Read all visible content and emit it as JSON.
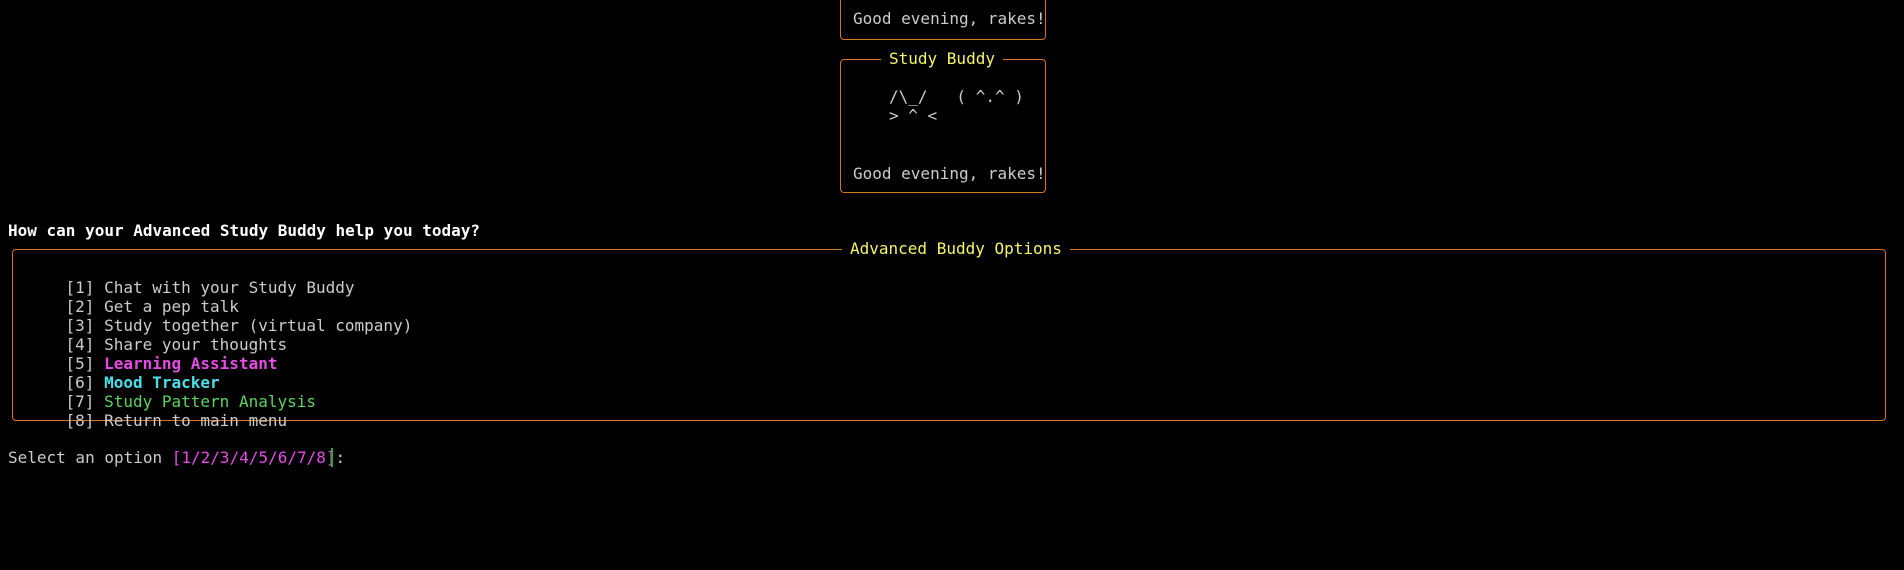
{
  "top_panel": {
    "greeting": "Good evening, rakes!"
  },
  "buddy_panel": {
    "title": "Study Buddy",
    "art_line1": "/\\_/   ( ^.^ )",
    "art_line2": "> ^ <",
    "greeting": "Good evening, rakes!"
  },
  "question": "How can your Advanced Study Buddy help you today?",
  "options_panel": {
    "title": "Advanced Buddy Options",
    "items": [
      {
        "num": "[1]",
        "label": "Chat with your Study Buddy"
      },
      {
        "num": "[2]",
        "label": "Get a pep talk"
      },
      {
        "num": "[3]",
        "label": "Study together (virtual company)"
      },
      {
        "num": "[4]",
        "label": "Share your thoughts"
      },
      {
        "num": "[5]",
        "label": "Learning Assistant"
      },
      {
        "num": "[6]",
        "label": "Mood Tracker"
      },
      {
        "num": "[7]",
        "label": "Study Pattern Analysis"
      },
      {
        "num": "[8]",
        "label": "Return to main menu"
      }
    ]
  },
  "prompt": {
    "text": "Select an option ",
    "choices": "[1/2/3/4/5/6/7/8]",
    "suffix": ":"
  },
  "colors": {
    "border": "#d9731c",
    "title": "#f5f56a",
    "magenta": "#e54ce5",
    "cyan": "#4ae0e8",
    "green": "#5fd35f",
    "text": "#cccccc"
  }
}
